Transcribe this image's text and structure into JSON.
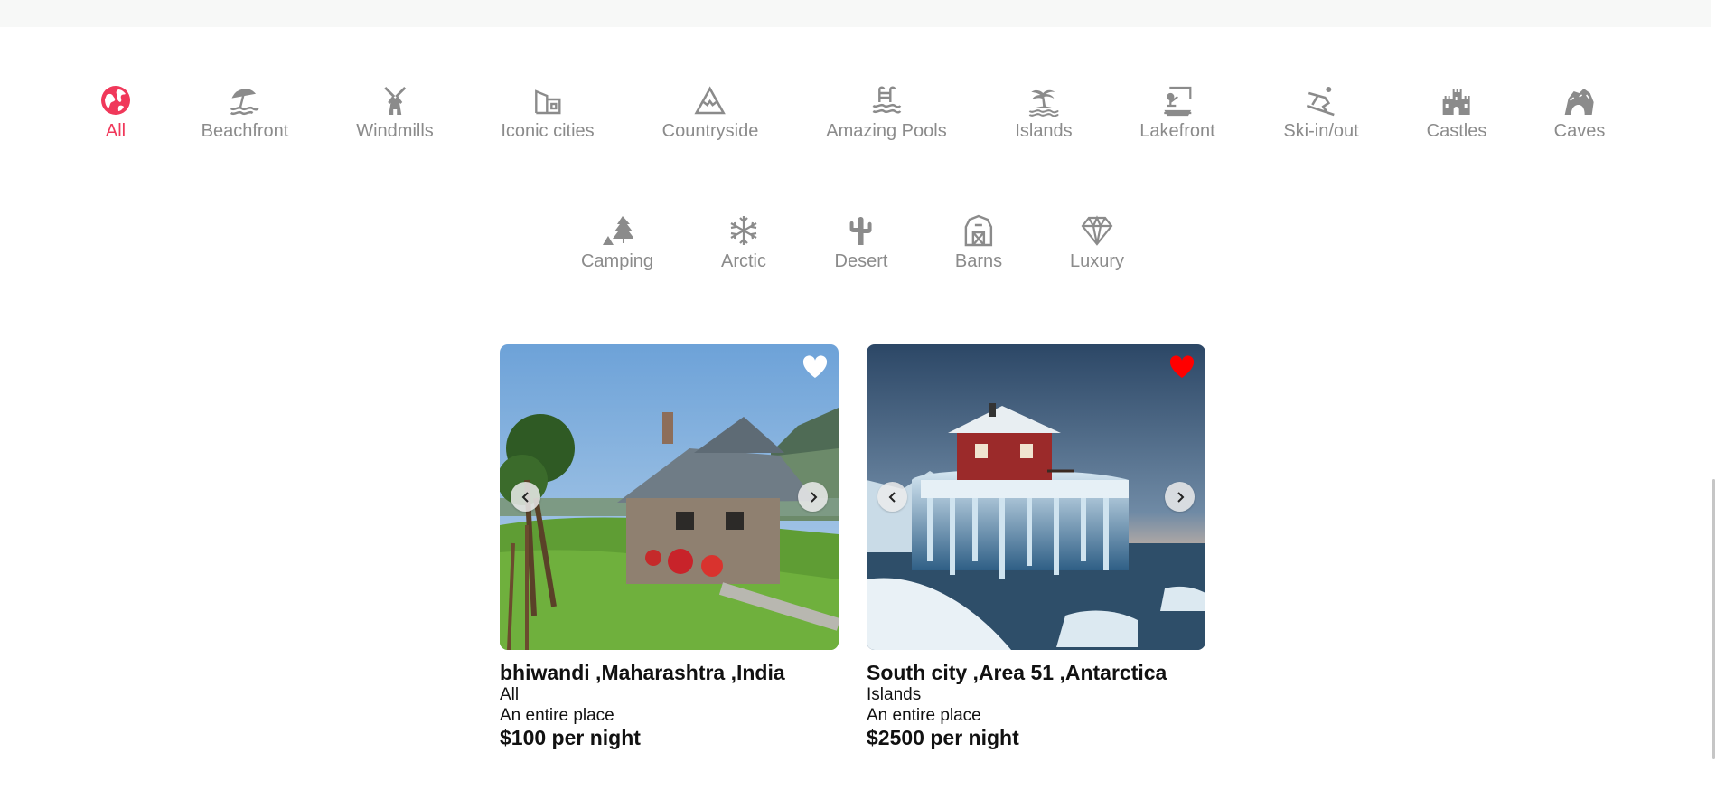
{
  "categories": [
    {
      "label": "All",
      "icon": "globe-icon",
      "active": true
    },
    {
      "label": "Beachfront",
      "icon": "beach-umbrella-icon",
      "active": false
    },
    {
      "label": "Windmills",
      "icon": "windmill-icon",
      "active": false
    },
    {
      "label": "Iconic cities",
      "icon": "city-building-icon",
      "active": false
    },
    {
      "label": "Countryside",
      "icon": "mountain-icon",
      "active": false
    },
    {
      "label": "Amazing Pools",
      "icon": "pool-icon",
      "active": false
    },
    {
      "label": "Islands",
      "icon": "palm-island-icon",
      "active": false
    },
    {
      "label": "Lakefront",
      "icon": "fishing-icon",
      "active": false
    },
    {
      "label": "Ski-in/out",
      "icon": "skier-icon",
      "active": false
    },
    {
      "label": "Castles",
      "icon": "castle-icon",
      "active": false
    },
    {
      "label": "Caves",
      "icon": "cave-icon",
      "active": false
    },
    {
      "label": "Camping",
      "icon": "camping-tent-icon",
      "active": false
    },
    {
      "label": "Arctic",
      "icon": "snowflake-icon",
      "active": false
    },
    {
      "label": "Desert",
      "icon": "cactus-icon",
      "active": false
    },
    {
      "label": "Barns",
      "icon": "barn-icon",
      "active": false
    },
    {
      "label": "Luxury",
      "icon": "diamond-icon",
      "active": false
    }
  ],
  "colors": {
    "accent": "#f0385a",
    "inactive": "#8b8b8b",
    "heart_on": "#ff0000",
    "heart_off": "#ffffff"
  },
  "listings": [
    {
      "title": "bhiwandi ,Maharashtra ,India",
      "category": "All",
      "type": "An entire place",
      "price": "$100 per night",
      "favorited": false
    },
    {
      "title": "South city ,Area 51 ,Antarctica",
      "category": "Islands",
      "type": "An entire place",
      "price": "$2500 per night",
      "favorited": true
    }
  ]
}
